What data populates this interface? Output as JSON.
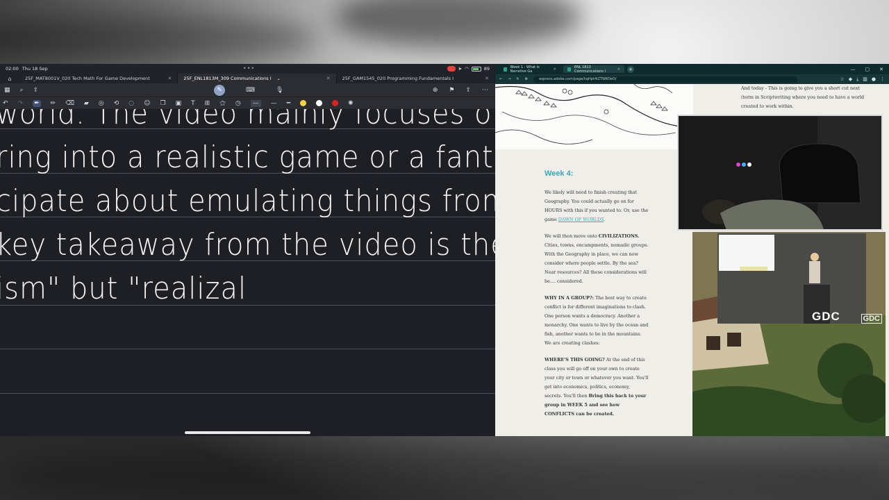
{
  "status_bar": {
    "time": "02:00",
    "date": "Thu 18 Sep",
    "battery": "89"
  },
  "notes_tabs": [
    {
      "label": "25F_MAT8001V_020 Tech Math For Game Development"
    },
    {
      "label": "25F_ENL1813M_309 Communications I"
    },
    {
      "label": "25F_GAM1545_020 Programming Fundamentals I"
    }
  ],
  "handwriting": {
    "line1": "world. The video mainly focuses on be",
    "line2": "ring into a realistic game or a fantasy a",
    "line3": "cipate about emulating things from the r",
    "line4": "key takeaway from the video is the idea",
    "line5": "ism\" but \"realizal"
  },
  "browser": {
    "tabs": [
      {
        "label": "Week 1 - What is Narrative Ga"
      },
      {
        "label": "ENL 1813 Communications I"
      }
    ],
    "url": "express.adobe.com/page/hqHpt4iZTWKOeO/"
  },
  "page": {
    "top_right_text": "And today - This is going to give you a short cut next (term in Scriptwriting where you need to have a world created to work within.",
    "week_title": "Week 4:",
    "p1_before": "We likely will need to finish creating that Geography. You could actually go on for HOURS with this if you wanted to. Or, use the game ",
    "p1_link": "DAWN OF WORLDS",
    "p1_after": ".",
    "p2_before": "We will then move onto ",
    "p2_bold": "CIVILIZATIONS.",
    "p2_after": " Cities, towns, encampments, nomadic groups. With the Geography in place, we can now consider where people settle. By the sea? Near resources? All these considerations will be.... considered.",
    "p3_bold": "WHY IN A GROUP?:",
    "p3_after": " The best way to create conflict is for different imaginations to clash. One person wants a democracy. Another a monarchy. One wants to live by the ocean and fish, another wants to be in the mountains. We are creating clashes.",
    "p4_bold": "WHERE'S THIS GOING?",
    "p4_mid": " At the end of this class you will go off on your own to create your city or town or whatever you want. You'll get into economics, politics, economy, secrets. You'll then ",
    "p4_bold2": "Bring this back to your group in WEEK 5 and see how CONFLICTS can be created."
  },
  "gdc_logo": "GDC",
  "gdc_logo_small": "GDC",
  "icons": [
    "home-icon",
    "grid-icon",
    "search-icon",
    "share-icon",
    "pen-icon",
    "highlighter-icon",
    "eraser-icon",
    "lasso-icon",
    "mic-icon",
    "undo-icon",
    "redo-icon",
    "refresh-icon",
    "star-icon"
  ],
  "colors": {
    "accent_teal": "#3aa8b5",
    "pen_yellow": "#f5d547",
    "pen_white": "#ffffff",
    "pen_red": "#d8261e"
  }
}
